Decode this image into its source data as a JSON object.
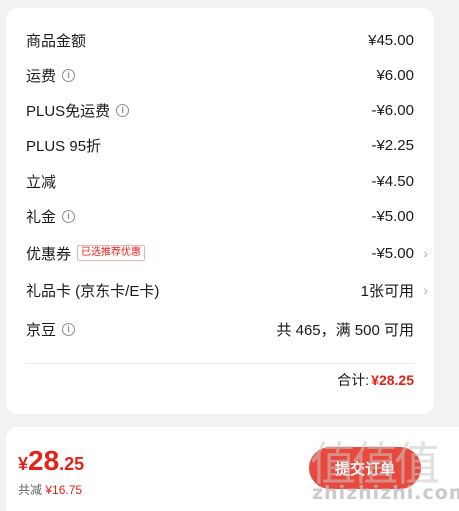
{
  "rows": [
    {
      "label": "商品金额",
      "value": "¥45.00"
    },
    {
      "label": "运费",
      "value": "¥6.00",
      "info_icon": "info-icon"
    },
    {
      "label": "PLUS免运费",
      "value": "-¥6.00",
      "info_icon": "info-icon"
    },
    {
      "label": "PLUS 95折",
      "value": "-¥2.25"
    },
    {
      "label": "立减",
      "value": "-¥4.50"
    },
    {
      "label": "礼金",
      "value": "-¥5.00",
      "info_icon": "info-icon"
    },
    {
      "label": "优惠券",
      "tag": "已选推荐优惠",
      "value": "-¥5.00"
    },
    {
      "label": "礼品卡 (京东卡/E卡)",
      "value": "1张可用"
    },
    {
      "label": "京豆",
      "value": "共 465，满 500 可用",
      "info_icon": "info-icon"
    }
  ],
  "total": {
    "label": "合计:",
    "value": "¥28.25"
  },
  "bottom": {
    "currency": "¥",
    "price_int": "28",
    "price_dec": ".25",
    "saved_label": "共减",
    "saved_value": "¥16.75",
    "submit_label": "提交订单"
  },
  "watermark": {
    "big": "值值值",
    "small": "zhizhizhi.com"
  },
  "colors": {
    "accent": "#e2231a",
    "button": "#e9483c",
    "background": "#f2f2f2"
  }
}
